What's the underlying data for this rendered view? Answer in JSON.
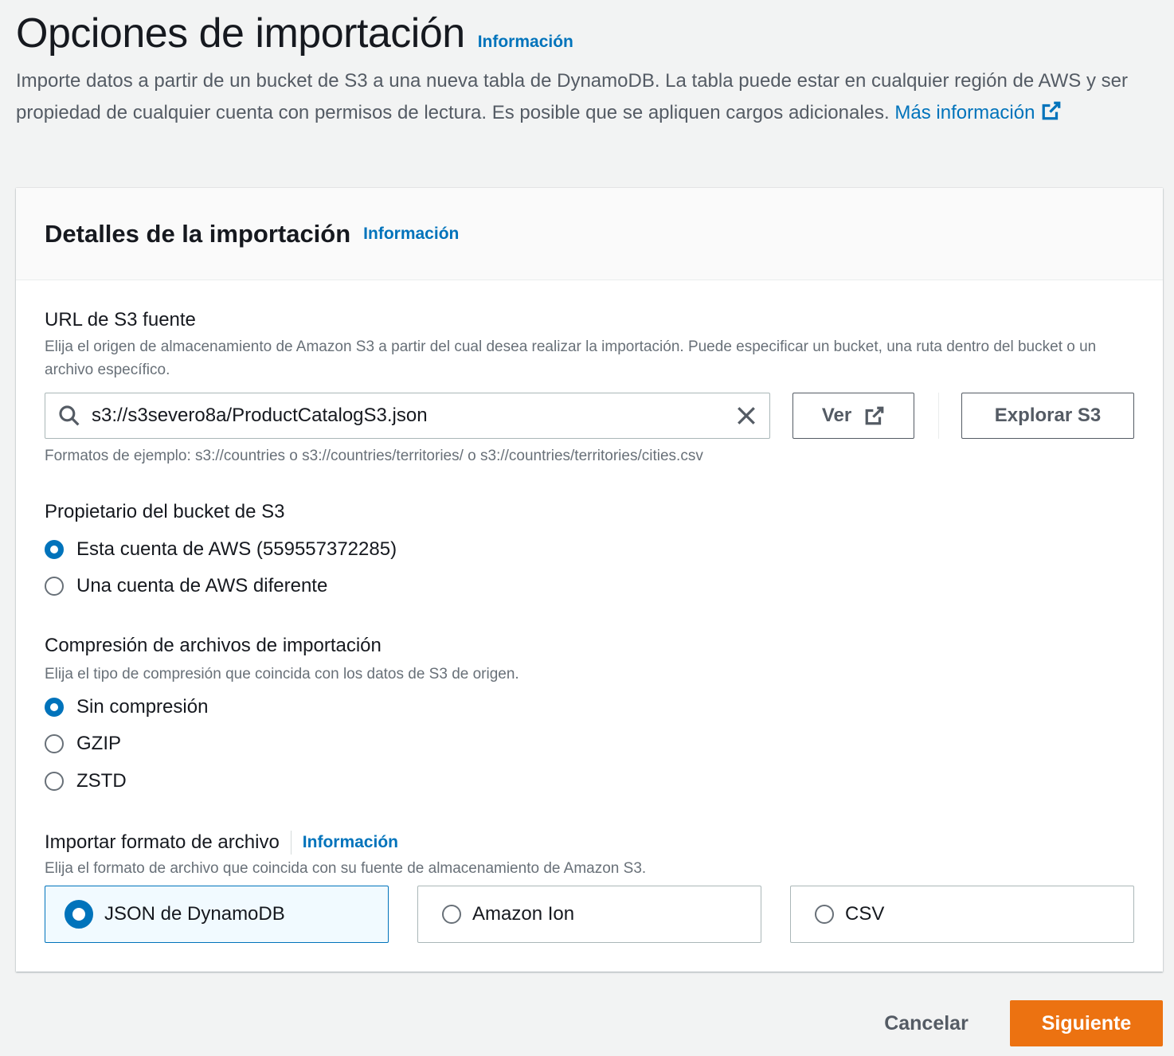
{
  "header": {
    "title": "Opciones de importación",
    "info": "Información",
    "description": "Importe datos a partir de un bucket de S3 a una nueva tabla de DynamoDB. La tabla puede estar en cualquier región de AWS y ser propiedad de cualquier cuenta con permisos de lectura. Es posible que se apliquen cargos adicionales.",
    "more_info_link": "Más información"
  },
  "panel": {
    "title": "Detalles de la importación",
    "info": "Información"
  },
  "source_url": {
    "label": "URL de S3 fuente",
    "description": "Elija el origen de almacenamiento de Amazon S3 a partir del cual desea realizar la importación. Puede especificar un bucket, una ruta dentro del bucket o un archivo específico.",
    "value": "s3://s3severo8a/ProductCatalogS3.json",
    "view_button": "Ver",
    "browse_button": "Explorar S3",
    "hint": "Formatos de ejemplo: s3://countries o s3://countries/territories/ o s3://countries/territories/cities.csv"
  },
  "bucket_owner": {
    "label": "Propietario del bucket de S3",
    "options": [
      {
        "label": "Esta cuenta de AWS (559557372285)",
        "selected": true
      },
      {
        "label": "Una cuenta de AWS diferente",
        "selected": false
      }
    ]
  },
  "compression": {
    "label": "Compresión de archivos de importación",
    "description": "Elija el tipo de compresión que coincida con los datos de S3 de origen.",
    "options": [
      {
        "label": "Sin compresión",
        "selected": true
      },
      {
        "label": "GZIP",
        "selected": false
      },
      {
        "label": "ZSTD",
        "selected": false
      }
    ]
  },
  "file_format": {
    "label": "Importar formato de archivo",
    "info": "Información",
    "description": "Elija el formato de archivo que coincida con su fuente de almacenamiento de Amazon S3.",
    "options": [
      {
        "label": "JSON de DynamoDB",
        "selected": true
      },
      {
        "label": "Amazon Ion",
        "selected": false
      },
      {
        "label": "CSV",
        "selected": false
      }
    ]
  },
  "footer": {
    "cancel": "Cancelar",
    "next": "Siguiente"
  },
  "colors": {
    "link": "#0073bb",
    "primary": "#ec7211",
    "background": "#f2f3f3"
  },
  "icons": [
    "external-link-icon",
    "search-icon",
    "close-icon"
  ]
}
